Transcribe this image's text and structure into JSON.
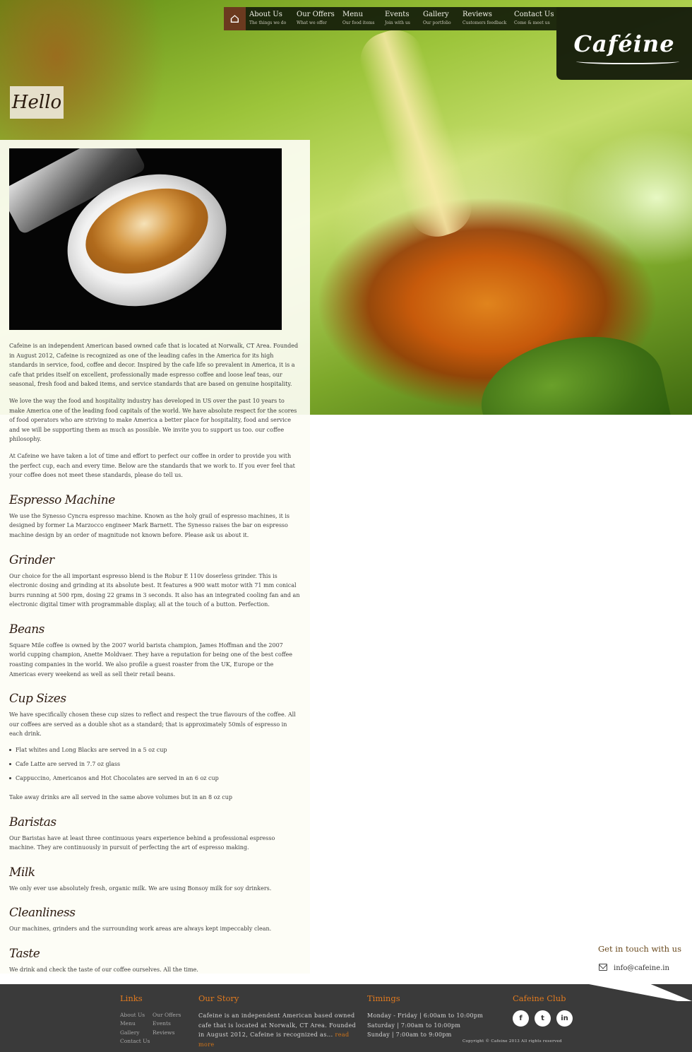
{
  "brand": {
    "logo": "Caféine"
  },
  "nav": {
    "items": [
      {
        "title": "About Us",
        "sub": "The things we do"
      },
      {
        "title": "Our Offers",
        "sub": "What we offer"
      },
      {
        "title": "Menu",
        "sub": "Our food items"
      },
      {
        "title": "Events",
        "sub": "Join with us"
      },
      {
        "title": "Gallery",
        "sub": "Our portfolio"
      },
      {
        "title": "Reviews",
        "sub": "Customers feedback"
      },
      {
        "title": "Contact Us",
        "sub": "Come & meet us"
      }
    ]
  },
  "hello": "Hello",
  "intro": [
    "Cafeine is an independent American based owned cafe that is located at Norwalk, CT Area. Founded in August 2012, Cafeine is recognized as one of the leading cafes in the America for its high standards in service, food, coffee and decor. Inspired by the cafe life so prevalent in America, it is a cafe that prides itself on excellent, professionally made espresso coffee and loose leaf teas, our seasonal, fresh food and baked items, and service standards that are based on genuine hospitality.",
    "We love the way the food and hospitality industry has developed in US over the past 10 years to make America one of the leading food capitals of the world. We have absolute respect for the scores of food operators who are striving to make America a better place for hospitality, food and service and we will be supporting them as much as possible. We invite you to support us too. our coffee philosophy.",
    "At Cafeine we have taken a lot of time and effort to perfect our coffee in order to provide you with the perfect cup, each and every time. Below are the standards that we work to. If you ever feel that your coffee does not meet these standards, please do tell us."
  ],
  "sections": {
    "espresso": {
      "title": "Espresso Machine",
      "text": "We use the Synesso Cyncra espresso machine. Known as the holy grail of espresso machines, it is designed by former La Marzocco engineer Mark Barnett. The Synesso raises the bar on espresso machine design by an order of magnitude not known before. Please ask us about it."
    },
    "grinder": {
      "title": "Grinder",
      "text": "Our choice for the all important espresso blend is the Robur E 110v doserless grinder. This is electronic dosing and grinding at its absolute best. It features a 900 watt motor with 71 mm conical burrs running at 500 rpm, dosing 22 grams in 3 seconds. It also has an integrated cooling fan and an electronic digital timer with programmable display, all at the touch of a button. Perfection."
    },
    "beans": {
      "title": "Beans",
      "text": "Square Mile coffee is owned by the 2007 world barista champion, James Hoffman and the 2007 world cupping champion, Anette Moldvaer. They have a reputation for being one of the best coffee roasting companies in the world. We also profile a guest roaster from the UK, Europe or the Americas every weekend as well as sell their retail beans."
    },
    "cups": {
      "title": "Cup Sizes",
      "text": "We have specifically chosen these cup sizes to reflect and respect the true flavours of the coffee. All our coffees are served as a double shot as a standard; that is approximately 50mls of espresso in each drink.",
      "bullets": [
        "Flat whites and Long Blacks are served in a 5 oz cup",
        "Cafe Latte are served in 7.7 oz glass",
        "Cappuccino, Americanos and Hot Chocolates are served in an 6 oz cup"
      ],
      "after": "Take away drinks are all served in the same above volumes but in an 8 oz cup"
    },
    "baristas": {
      "title": "Baristas",
      "text": "Our Baristas have at least three continuous years experience behind a professional espresso machine. They are continuously in pursuit of perfecting the art of espresso making."
    },
    "milk": {
      "title": "Milk",
      "text": "We only ever use absolutely fresh, organic milk. We are using Bonsoy milk for soy drinkers."
    },
    "cleanliness": {
      "title": "Cleanliness",
      "text": "Our machines, grinders and the surrounding work areas are always kept impeccably clean."
    },
    "taste": {
      "title": "Taste",
      "text": "We drink and check the taste of our coffee ourselves. All the time."
    }
  },
  "touch": {
    "title": "Get in touch with us",
    "email": "info@cafeine.in",
    "icon": "envelope-icon"
  },
  "footer": {
    "links_title": "Links",
    "links": [
      "About Us",
      "Our Offers",
      "Menu",
      "Events",
      "Gallery",
      "Reviews",
      "Contact Us"
    ],
    "story_title": "Our Story",
    "story_text": "Cafeine is an independent American based owned cafe that is located at Norwalk, CT Area. Founded in August 2012, Cafeine is recognized as...",
    "read_more": "read more",
    "timings_title": "Timings",
    "timings": [
      "Monday - Friday | 6:00am to 10:00pm",
      "Saturday | 7:00am to 10:00pm",
      "Sunday | 7:00am to 9:00pm"
    ],
    "club_title": "Cafeine Club",
    "social": [
      {
        "icon": "facebook-icon",
        "glyph": "f"
      },
      {
        "icon": "twitter-icon",
        "glyph": "t"
      },
      {
        "icon": "linkedin-icon",
        "glyph": "in"
      }
    ],
    "copyright": "Copyright © Cafeine 2013 All rights reserved"
  },
  "colors": {
    "accent": "#e07a1f",
    "nav_bg": "#141c0a",
    "home_bg": "#6b3a1f",
    "footer_bg": "#3a3a3a"
  }
}
